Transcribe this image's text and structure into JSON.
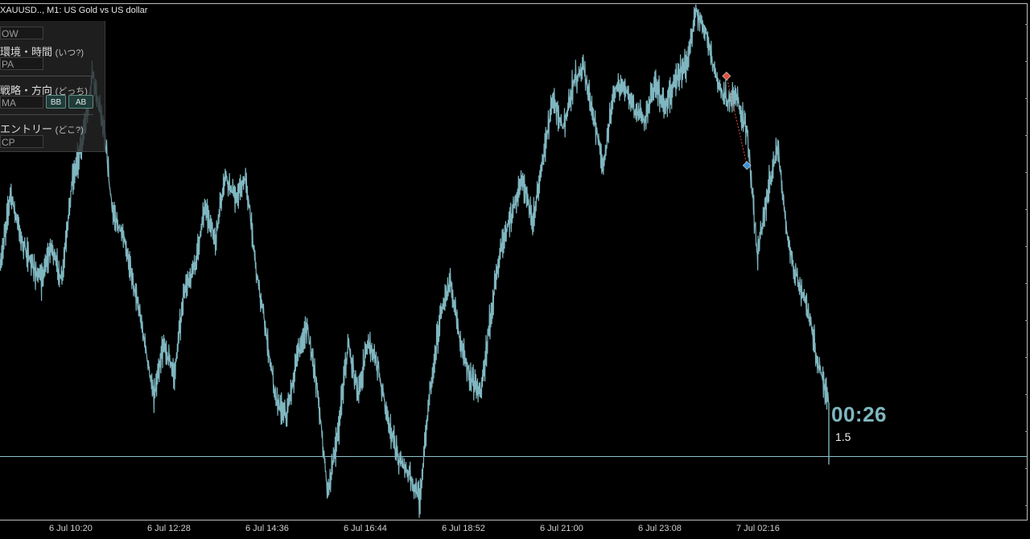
{
  "chart": {
    "title": "XAUUSD.., M1:  US Gold vs US dollar"
  },
  "panel": {
    "box1": "OW",
    "label1": "環境・時間",
    "label1_q": "(いつ?)",
    "box2": "PA",
    "label2": "戦略・方向",
    "label2_q": "(どっち)",
    "box3": "MA",
    "btn_bb": "BB",
    "btn_ab": "AB",
    "label3": "エントリー",
    "label3_q": "(どこ?)",
    "box4": "CP"
  },
  "overlay": {
    "timer": "00:26",
    "spread": "1.5"
  },
  "colors": {
    "background": "#000000",
    "series": "#7fb6c0",
    "sell_marker": "#e0503c",
    "buy_marker": "#3f8fd8",
    "current_price_line": "#8fc3cc"
  },
  "chart_data": {
    "type": "line",
    "x_tick_labels": [
      "6 Jul 10:20",
      "6 Jul 12:28",
      "6 Jul 14:36",
      "6 Jul 16:44",
      "6 Jul 18:52",
      "6 Jul 21:00",
      "6 Jul 23:08",
      "7 Jul 02:16"
    ],
    "series": [
      {
        "values": [
          0.55,
          0.72,
          0.62,
          0.56,
          0.52,
          0.6,
          0.52,
          0.74,
          0.83,
          0.98,
          0.88,
          0.67,
          0.62,
          0.52,
          0.4,
          0.26,
          0.38,
          0.31,
          0.5,
          0.55,
          0.69,
          0.61,
          0.76,
          0.7,
          0.75,
          0.55,
          0.4,
          0.25,
          0.22,
          0.35,
          0.42,
          0.28,
          0.05,
          0.18,
          0.38,
          0.27,
          0.39,
          0.32,
          0.2,
          0.12,
          0.09,
          0.03,
          0.28,
          0.44,
          0.52,
          0.38,
          0.3,
          0.28,
          0.46,
          0.6,
          0.67,
          0.75,
          0.65,
          0.78,
          0.93,
          0.86,
          0.96,
          1.0,
          0.88,
          0.78,
          0.95,
          0.96,
          0.9,
          0.88,
          0.96,
          0.91,
          0.97,
          1.0,
          1.12,
          1.07,
          0.97,
          0.92,
          0.93,
          0.85,
          0.58,
          0.72,
          0.82,
          0.6,
          0.52,
          0.45,
          0.33,
          0.25
        ]
      }
    ],
    "markers": [
      {
        "type": "sell",
        "index": 71
      },
      {
        "type": "buy",
        "index": 73
      }
    ],
    "current_price_level": 0.13
  }
}
